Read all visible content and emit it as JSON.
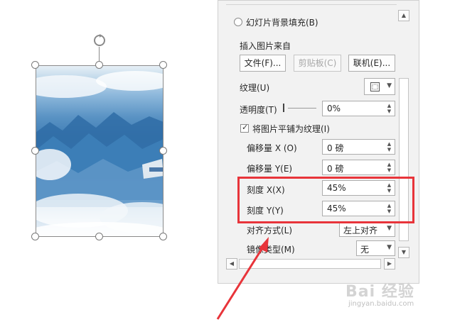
{
  "pane": {
    "fill_option": {
      "label": "幻灯片背景填充(B)"
    },
    "insert_from": {
      "label": "插入图片来自",
      "buttons": [
        {
          "label": "文件(F)..."
        },
        {
          "label": "剪贴板(C)"
        },
        {
          "label": "联机(E)..."
        }
      ]
    },
    "texture": {
      "label": "纹理(U)"
    },
    "transparency": {
      "label": "透明度(T)",
      "value": "0%"
    },
    "tile_checkbox": {
      "label": "将图片平铺为纹理(I)",
      "checked": true
    },
    "offset_x": {
      "label": "偏移量 X (O)",
      "value": "0 磅"
    },
    "offset_y": {
      "label": "偏移量 Y(E)",
      "value": "0 磅"
    },
    "scale_x": {
      "label": "刻度 X(X)",
      "value": "45%"
    },
    "scale_y": {
      "label": "刻度 Y(Y)",
      "value": "45%"
    },
    "alignment": {
      "label": "对齐方式(L)",
      "value": "左上对齐"
    },
    "mirror_type": {
      "label": "镜像类型(M)",
      "value": "无"
    }
  },
  "annotation": {
    "highlight_color": "#e8343a"
  },
  "watermark": {
    "main": "Bai 经验",
    "sub": "jingyan.baidu.com"
  }
}
